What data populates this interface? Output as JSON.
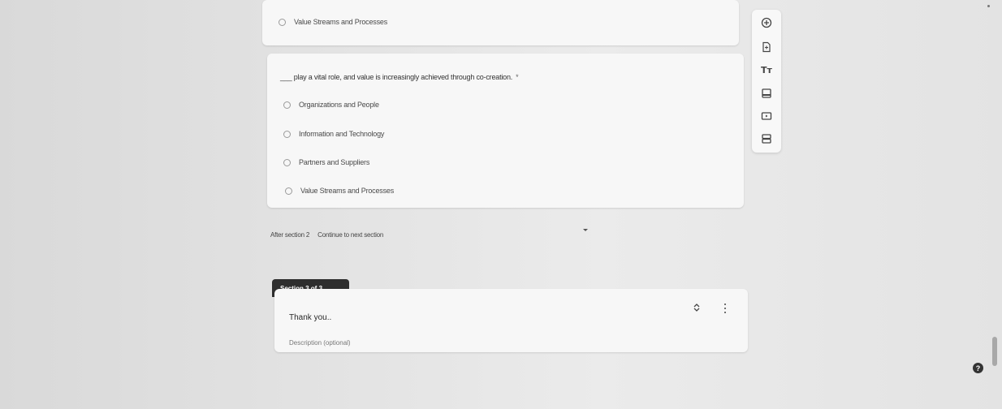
{
  "previous_question": {
    "options": [
      "Value Streams and Processes"
    ]
  },
  "question": {
    "title": "___ play a vital role, and value is increasingly achieved through co-creation.",
    "required_mark": "*",
    "options": [
      "Organizations and People",
      "Information and Technology",
      "Partners and Suppliers",
      "Value Streams and Processes"
    ]
  },
  "after_section": {
    "label": "After section 2",
    "value": "Continue to next section"
  },
  "section": {
    "tab_label": "Section 3 of 3",
    "title": "Thank you..",
    "description_placeholder": "Description (optional)"
  },
  "toolbar": {
    "add_question": "add-question-icon",
    "import_questions": "import-questions-icon",
    "add_title": "Tт",
    "add_image": "image-icon",
    "add_video": "video-icon",
    "add_section": "section-icon"
  },
  "help": {
    "label": "?"
  }
}
